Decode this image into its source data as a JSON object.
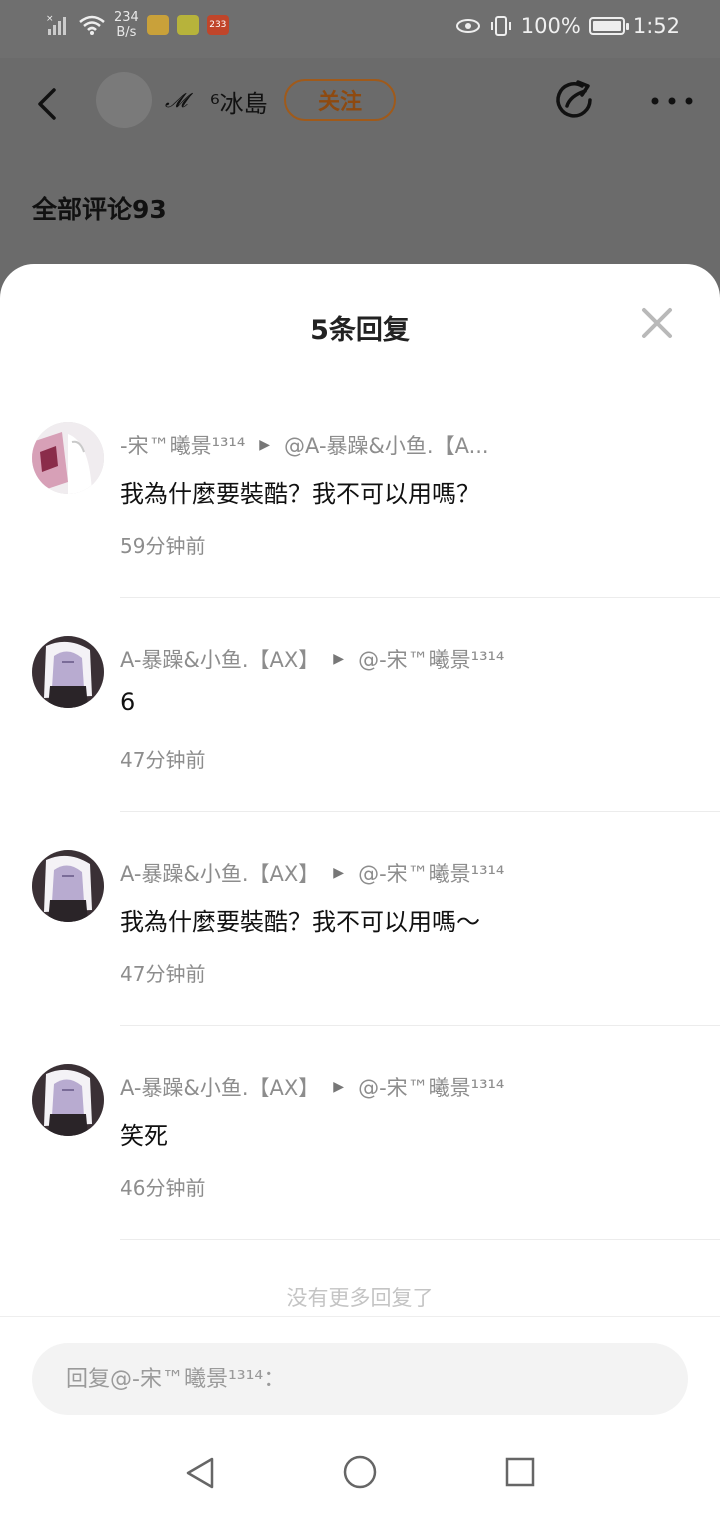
{
  "status_bar": {
    "net_speed_value": "234",
    "net_speed_unit": "B/s",
    "battery": "100%",
    "battery_level": 1.0,
    "time": "1:52",
    "app_badge_text": "233"
  },
  "header": {
    "logo_text": "𝓜",
    "user_name": "⁶冰島",
    "follow_label": "关注"
  },
  "comments_header": "全部评论93",
  "sheet": {
    "title": "5条回复"
  },
  "replies": [
    {
      "author": "-宋™曦景¹³¹⁴",
      "reply_to": "@A-暴躁&小鱼.【A...",
      "text": "我為什麼要裝酷？我不可以用嗎？",
      "time": "59分钟前"
    },
    {
      "author": "A-暴躁&小鱼.【AX】",
      "reply_to": "@-宋™曦景¹³¹⁴",
      "text": "6",
      "time": "47分钟前"
    },
    {
      "author": "A-暴躁&小鱼.【AX】",
      "reply_to": "@-宋™曦景¹³¹⁴",
      "text": "我為什麼要裝酷？我不可以用嗎～",
      "time": "47分钟前"
    },
    {
      "author": "A-暴躁&小鱼.【AX】",
      "reply_to": "@-宋™曦景¹³¹⁴",
      "text": "笑死",
      "time": "46分钟前"
    }
  ],
  "no_more_text": "没有更多回复了",
  "input": {
    "placeholder": "回复@-宋™曦景¹³¹⁴："
  }
}
